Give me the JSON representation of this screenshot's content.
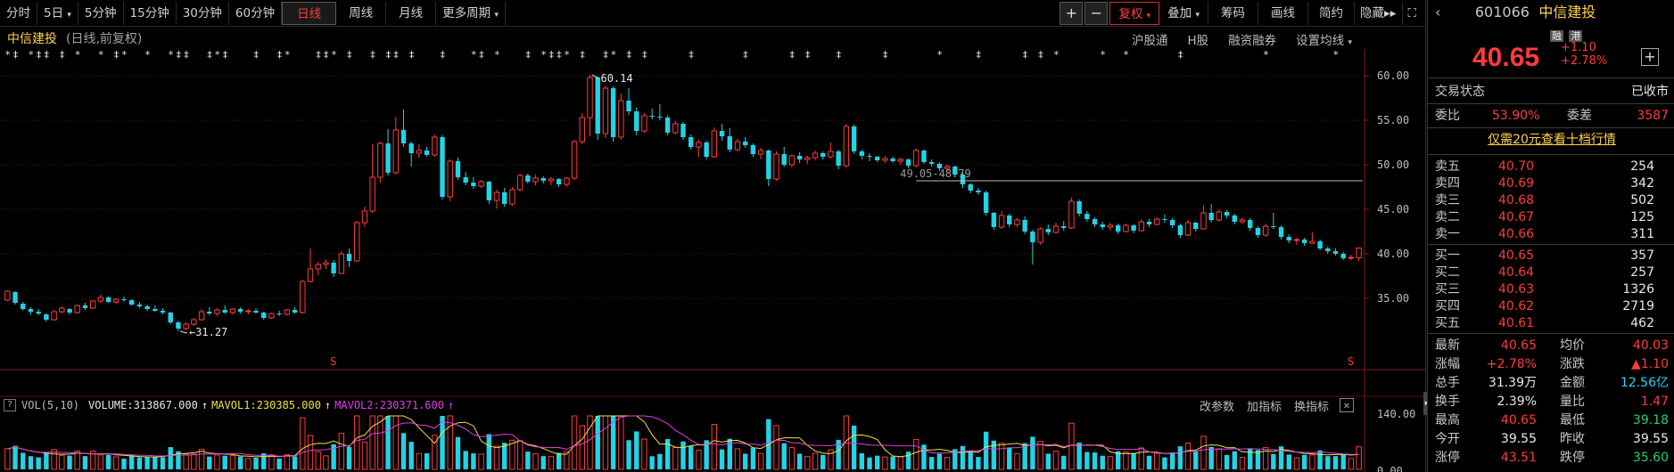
{
  "toolbar": {
    "periods": [
      "分时",
      "5日",
      "5分钟",
      "15分钟",
      "30分钟",
      "60分钟",
      "日线",
      "周线",
      "月线",
      "更多周期"
    ],
    "active_period": "日线",
    "right_buttons": [
      "复权",
      "叠加",
      "筹码",
      "画线",
      "简约",
      "隐藏"
    ],
    "plus": "+",
    "minus": "−"
  },
  "chart_header": {
    "stock_name": "中信建投",
    "subtitle": "(日线,前复权)",
    "links": [
      "沪股通",
      "H股",
      "融资融券",
      "设置均线"
    ]
  },
  "volume_header": {
    "indicator": "VOL(5,10)",
    "volume": "VOLUME:313867.000",
    "mavol1": "MAVOL1:230385.000",
    "mavol2": "MAVOL2:230371.600",
    "links": [
      "改参数",
      "加指标",
      "换指标"
    ]
  },
  "chart_data": {
    "type": "candlestick",
    "price_axis_ticks": [
      "60.00",
      "55.00",
      "50.00",
      "45.00",
      "40.00",
      "35.00"
    ],
    "ylim": [
      31.5,
      61.0
    ],
    "volume_axis_ticks": [
      "140.00",
      "0.00"
    ],
    "high_label": "60.14",
    "low_label": "31.27",
    "range_line_label": "49.05-48.79",
    "candles": [
      {
        "o": 34.8,
        "h": 35.9,
        "l": 34.7,
        "c": 35.8
      },
      {
        "o": 35.7,
        "h": 35.8,
        "l": 34.3,
        "c": 34.5
      },
      {
        "o": 34.4,
        "h": 34.6,
        "l": 33.6,
        "c": 33.8
      },
      {
        "o": 33.8,
        "h": 34.0,
        "l": 33.2,
        "c": 33.5
      },
      {
        "o": 33.5,
        "h": 33.8,
        "l": 33.1,
        "c": 33.3
      },
      {
        "o": 33.2,
        "h": 33.3,
        "l": 32.4,
        "c": 32.6
      },
      {
        "o": 32.6,
        "h": 33.7,
        "l": 32.5,
        "c": 33.5
      },
      {
        "o": 33.5,
        "h": 34.1,
        "l": 33.3,
        "c": 33.9
      },
      {
        "o": 33.8,
        "h": 33.9,
        "l": 33.2,
        "c": 33.4
      },
      {
        "o": 33.4,
        "h": 34.3,
        "l": 33.3,
        "c": 34.2
      },
      {
        "o": 34.2,
        "h": 34.5,
        "l": 33.7,
        "c": 33.9
      },
      {
        "o": 33.9,
        "h": 34.8,
        "l": 33.8,
        "c": 34.7
      },
      {
        "o": 34.7,
        "h": 35.4,
        "l": 34.5,
        "c": 35.1
      },
      {
        "o": 35.1,
        "h": 35.2,
        "l": 34.5,
        "c": 34.6
      },
      {
        "o": 34.6,
        "h": 35.0,
        "l": 34.4,
        "c": 34.9
      },
      {
        "o": 34.9,
        "h": 35.2,
        "l": 34.6,
        "c": 34.8
      },
      {
        "o": 34.8,
        "h": 34.9,
        "l": 34.2,
        "c": 34.3
      },
      {
        "o": 34.3,
        "h": 34.6,
        "l": 33.9,
        "c": 34.1
      },
      {
        "o": 34.1,
        "h": 34.3,
        "l": 33.6,
        "c": 33.8
      },
      {
        "o": 33.8,
        "h": 34.2,
        "l": 33.5,
        "c": 33.6
      },
      {
        "o": 33.6,
        "h": 33.9,
        "l": 33.2,
        "c": 33.4
      },
      {
        "o": 33.4,
        "h": 33.5,
        "l": 32.1,
        "c": 32.3
      },
      {
        "o": 32.3,
        "h": 32.5,
        "l": 31.3,
        "c": 31.6
      },
      {
        "o": 31.6,
        "h": 32.3,
        "l": 31.4,
        "c": 32.1
      },
      {
        "o": 32.1,
        "h": 32.8,
        "l": 31.9,
        "c": 32.6
      },
      {
        "o": 32.6,
        "h": 33.8,
        "l": 32.5,
        "c": 33.5
      },
      {
        "o": 33.5,
        "h": 34.0,
        "l": 33.1,
        "c": 33.3
      },
      {
        "o": 33.3,
        "h": 33.9,
        "l": 33.0,
        "c": 33.7
      },
      {
        "o": 33.7,
        "h": 34.2,
        "l": 33.3,
        "c": 33.4
      },
      {
        "o": 33.4,
        "h": 33.9,
        "l": 33.2,
        "c": 33.8
      },
      {
        "o": 33.8,
        "h": 34.0,
        "l": 33.3,
        "c": 33.5
      },
      {
        "o": 33.5,
        "h": 33.8,
        "l": 33.2,
        "c": 33.6
      },
      {
        "o": 33.6,
        "h": 33.9,
        "l": 33.3,
        "c": 33.4
      },
      {
        "o": 33.4,
        "h": 33.5,
        "l": 32.6,
        "c": 32.8
      },
      {
        "o": 32.8,
        "h": 33.4,
        "l": 32.7,
        "c": 33.3
      },
      {
        "o": 33.3,
        "h": 33.6,
        "l": 33.0,
        "c": 33.2
      },
      {
        "o": 33.2,
        "h": 33.8,
        "l": 33.1,
        "c": 33.7
      },
      {
        "o": 33.7,
        "h": 34.0,
        "l": 33.3,
        "c": 33.4
      },
      {
        "o": 33.4,
        "h": 37.1,
        "l": 33.3,
        "c": 36.9
      },
      {
        "o": 36.9,
        "h": 40.6,
        "l": 36.8,
        "c": 38.3
      },
      {
        "o": 38.3,
        "h": 39.1,
        "l": 37.6,
        "c": 38.8
      },
      {
        "o": 38.8,
        "h": 39.4,
        "l": 38.3,
        "c": 39.0
      },
      {
        "o": 39.0,
        "h": 39.3,
        "l": 37.4,
        "c": 37.8
      },
      {
        "o": 37.8,
        "h": 40.3,
        "l": 37.7,
        "c": 40.0
      },
      {
        "o": 40.0,
        "h": 40.6,
        "l": 38.5,
        "c": 39.2
      },
      {
        "o": 39.2,
        "h": 43.7,
        "l": 39.1,
        "c": 43.5
      },
      {
        "o": 43.5,
        "h": 45.3,
        "l": 43.0,
        "c": 44.8
      },
      {
        "o": 44.8,
        "h": 52.3,
        "l": 44.6,
        "c": 48.6
      },
      {
        "o": 48.6,
        "h": 52.6,
        "l": 48.0,
        "c": 52.4
      },
      {
        "o": 52.4,
        "h": 54.0,
        "l": 48.8,
        "c": 49.1
      },
      {
        "o": 49.1,
        "h": 55.4,
        "l": 48.9,
        "c": 53.9
      },
      {
        "o": 53.9,
        "h": 56.2,
        "l": 52.0,
        "c": 52.4
      },
      {
        "o": 52.4,
        "h": 52.6,
        "l": 49.8,
        "c": 51.3
      },
      {
        "o": 51.3,
        "h": 52.3,
        "l": 50.8,
        "c": 51.6
      },
      {
        "o": 51.6,
        "h": 52.0,
        "l": 50.9,
        "c": 51.1
      },
      {
        "o": 51.1,
        "h": 53.4,
        "l": 50.9,
        "c": 53.1
      },
      {
        "o": 53.1,
        "h": 53.3,
        "l": 46.1,
        "c": 46.4
      },
      {
        "o": 46.4,
        "h": 50.6,
        "l": 45.9,
        "c": 50.4
      },
      {
        "o": 50.4,
        "h": 50.8,
        "l": 48.3,
        "c": 48.6
      },
      {
        "o": 48.6,
        "h": 49.2,
        "l": 47.7,
        "c": 48.0
      },
      {
        "o": 48.0,
        "h": 48.6,
        "l": 47.3,
        "c": 47.6
      },
      {
        "o": 47.6,
        "h": 48.3,
        "l": 47.4,
        "c": 48.1
      },
      {
        "o": 48.1,
        "h": 48.2,
        "l": 45.6,
        "c": 46.0
      },
      {
        "o": 46.0,
        "h": 47.2,
        "l": 45.1,
        "c": 46.9
      },
      {
        "o": 46.9,
        "h": 47.4,
        "l": 45.3,
        "c": 45.6
      },
      {
        "o": 45.6,
        "h": 47.5,
        "l": 45.4,
        "c": 47.2
      },
      {
        "o": 47.2,
        "h": 49.0,
        "l": 47.0,
        "c": 48.8
      },
      {
        "o": 48.8,
        "h": 49.0,
        "l": 47.9,
        "c": 48.1
      },
      {
        "o": 48.1,
        "h": 48.9,
        "l": 47.7,
        "c": 48.5
      },
      {
        "o": 48.5,
        "h": 48.7,
        "l": 47.9,
        "c": 48.2
      },
      {
        "o": 48.2,
        "h": 48.6,
        "l": 47.7,
        "c": 48.4
      },
      {
        "o": 48.4,
        "h": 48.5,
        "l": 47.5,
        "c": 47.8
      },
      {
        "o": 47.8,
        "h": 48.6,
        "l": 47.5,
        "c": 48.5
      },
      {
        "o": 48.5,
        "h": 52.8,
        "l": 48.3,
        "c": 52.6
      },
      {
        "o": 52.6,
        "h": 55.8,
        "l": 52.3,
        "c": 55.3
      },
      {
        "o": 55.3,
        "h": 60.1,
        "l": 53.2,
        "c": 59.8
      },
      {
        "o": 59.8,
        "h": 59.9,
        "l": 52.8,
        "c": 53.5
      },
      {
        "o": 53.5,
        "h": 58.9,
        "l": 53.0,
        "c": 58.6
      },
      {
        "o": 58.6,
        "h": 58.8,
        "l": 52.6,
        "c": 53.1
      },
      {
        "o": 53.1,
        "h": 58.0,
        "l": 52.8,
        "c": 57.2
      },
      {
        "o": 57.2,
        "h": 58.6,
        "l": 55.6,
        "c": 56.0
      },
      {
        "o": 56.0,
        "h": 56.4,
        "l": 53.3,
        "c": 53.8
      },
      {
        "o": 53.8,
        "h": 55.8,
        "l": 53.6,
        "c": 55.5
      },
      {
        "o": 55.5,
        "h": 56.3,
        "l": 55.1,
        "c": 55.4
      },
      {
        "o": 55.4,
        "h": 56.8,
        "l": 55.0,
        "c": 55.3
      },
      {
        "o": 55.3,
        "h": 55.5,
        "l": 53.3,
        "c": 53.6
      },
      {
        "o": 53.6,
        "h": 54.9,
        "l": 53.4,
        "c": 54.6
      },
      {
        "o": 54.6,
        "h": 54.8,
        "l": 52.8,
        "c": 53.1
      },
      {
        "o": 53.1,
        "h": 53.4,
        "l": 51.7,
        "c": 52.0
      },
      {
        "o": 52.0,
        "h": 52.8,
        "l": 50.9,
        "c": 52.5
      },
      {
        "o": 52.5,
        "h": 52.7,
        "l": 50.6,
        "c": 50.9
      },
      {
        "o": 50.9,
        "h": 54.2,
        "l": 50.8,
        "c": 53.8
      },
      {
        "o": 53.8,
        "h": 54.6,
        "l": 52.7,
        "c": 53.2
      },
      {
        "o": 53.2,
        "h": 54.1,
        "l": 51.4,
        "c": 51.7
      },
      {
        "o": 51.7,
        "h": 52.9,
        "l": 51.5,
        "c": 52.6
      },
      {
        "o": 52.6,
        "h": 53.1,
        "l": 51.9,
        "c": 52.2
      },
      {
        "o": 52.2,
        "h": 52.4,
        "l": 50.9,
        "c": 51.2
      },
      {
        "o": 51.2,
        "h": 51.9,
        "l": 50.6,
        "c": 51.6
      },
      {
        "o": 51.6,
        "h": 51.7,
        "l": 47.6,
        "c": 48.4
      },
      {
        "o": 48.4,
        "h": 51.5,
        "l": 48.2,
        "c": 51.2
      },
      {
        "o": 51.2,
        "h": 52.0,
        "l": 49.8,
        "c": 50.0
      },
      {
        "o": 50.0,
        "h": 51.2,
        "l": 49.7,
        "c": 51.0
      },
      {
        "o": 51.0,
        "h": 51.4,
        "l": 50.2,
        "c": 50.6
      },
      {
        "o": 50.6,
        "h": 51.0,
        "l": 50.1,
        "c": 50.8
      },
      {
        "o": 50.8,
        "h": 51.6,
        "l": 50.5,
        "c": 51.3
      },
      {
        "o": 51.3,
        "h": 51.5,
        "l": 50.6,
        "c": 50.9
      },
      {
        "o": 50.9,
        "h": 52.5,
        "l": 50.7,
        "c": 51.5
      },
      {
        "o": 51.5,
        "h": 51.7,
        "l": 49.5,
        "c": 49.9
      },
      {
        "o": 49.9,
        "h": 54.6,
        "l": 49.7,
        "c": 54.3
      },
      {
        "o": 54.3,
        "h": 54.5,
        "l": 51.2,
        "c": 51.5
      },
      {
        "o": 51.5,
        "h": 51.7,
        "l": 50.6,
        "c": 51.0
      },
      {
        "o": 51.0,
        "h": 51.3,
        "l": 50.4,
        "c": 50.9
      },
      {
        "o": 50.9,
        "h": 51.0,
        "l": 50.3,
        "c": 50.5
      },
      {
        "o": 50.5,
        "h": 51.0,
        "l": 50.2,
        "c": 50.7
      },
      {
        "o": 50.7,
        "h": 50.9,
        "l": 50.2,
        "c": 50.4
      },
      {
        "o": 50.4,
        "h": 50.8,
        "l": 50.0,
        "c": 50.6
      },
      {
        "o": 50.6,
        "h": 50.7,
        "l": 49.6,
        "c": 49.9
      },
      {
        "o": 49.9,
        "h": 51.8,
        "l": 49.7,
        "c": 51.6
      },
      {
        "o": 51.6,
        "h": 51.7,
        "l": 50.1,
        "c": 50.3
      },
      {
        "o": 50.3,
        "h": 50.6,
        "l": 49.8,
        "c": 50.1
      },
      {
        "o": 50.1,
        "h": 50.3,
        "l": 49.3,
        "c": 49.6
      },
      {
        "o": 49.6,
        "h": 50.0,
        "l": 49.3,
        "c": 49.8
      },
      {
        "o": 49.8,
        "h": 49.9,
        "l": 48.6,
        "c": 48.9
      },
      {
        "o": 48.9,
        "h": 49.1,
        "l": 47.4,
        "c": 47.8
      },
      {
        "o": 47.8,
        "h": 47.9,
        "l": 46.8,
        "c": 47.1
      },
      {
        "o": 47.1,
        "h": 47.4,
        "l": 46.6,
        "c": 46.9
      },
      {
        "o": 46.9,
        "h": 47.1,
        "l": 44.3,
        "c": 44.6
      },
      {
        "o": 44.6,
        "h": 44.7,
        "l": 42.7,
        "c": 43.0
      },
      {
        "o": 43.0,
        "h": 44.8,
        "l": 42.8,
        "c": 44.3
      },
      {
        "o": 44.3,
        "h": 44.5,
        "l": 43.0,
        "c": 43.3
      },
      {
        "o": 43.3,
        "h": 44.0,
        "l": 43.0,
        "c": 43.8
      },
      {
        "o": 43.8,
        "h": 44.2,
        "l": 42.2,
        "c": 42.5
      },
      {
        "o": 42.5,
        "h": 42.7,
        "l": 38.8,
        "c": 41.3
      },
      {
        "o": 41.3,
        "h": 43.0,
        "l": 41.0,
        "c": 42.8
      },
      {
        "o": 42.8,
        "h": 43.3,
        "l": 42.1,
        "c": 42.4
      },
      {
        "o": 42.4,
        "h": 43.5,
        "l": 42.3,
        "c": 43.1
      },
      {
        "o": 43.1,
        "h": 43.7,
        "l": 42.6,
        "c": 42.9
      },
      {
        "o": 42.9,
        "h": 46.3,
        "l": 42.8,
        "c": 45.9
      },
      {
        "o": 45.9,
        "h": 46.1,
        "l": 44.2,
        "c": 44.5
      },
      {
        "o": 44.5,
        "h": 44.8,
        "l": 43.6,
        "c": 43.9
      },
      {
        "o": 43.9,
        "h": 44.1,
        "l": 43.0,
        "c": 43.3
      },
      {
        "o": 43.3,
        "h": 43.6,
        "l": 42.7,
        "c": 43.0
      },
      {
        "o": 43.0,
        "h": 43.5,
        "l": 42.6,
        "c": 43.2
      },
      {
        "o": 43.2,
        "h": 43.4,
        "l": 42.2,
        "c": 42.5
      },
      {
        "o": 42.5,
        "h": 43.4,
        "l": 42.4,
        "c": 43.2
      },
      {
        "o": 43.2,
        "h": 43.3,
        "l": 42.3,
        "c": 42.6
      },
      {
        "o": 42.6,
        "h": 43.9,
        "l": 42.5,
        "c": 43.6
      },
      {
        "o": 43.6,
        "h": 43.9,
        "l": 43.0,
        "c": 43.3
      },
      {
        "o": 43.3,
        "h": 44.1,
        "l": 43.2,
        "c": 43.9
      },
      {
        "o": 43.9,
        "h": 44.4,
        "l": 43.5,
        "c": 43.8
      },
      {
        "o": 43.8,
        "h": 44.0,
        "l": 42.9,
        "c": 43.2
      },
      {
        "o": 43.2,
        "h": 43.4,
        "l": 41.8,
        "c": 42.1
      },
      {
        "o": 42.1,
        "h": 43.8,
        "l": 42.0,
        "c": 43.5
      },
      {
        "o": 43.5,
        "h": 43.6,
        "l": 42.5,
        "c": 42.8
      },
      {
        "o": 42.8,
        "h": 45.4,
        "l": 42.7,
        "c": 44.6
      },
      {
        "o": 44.6,
        "h": 45.6,
        "l": 43.5,
        "c": 43.8
      },
      {
        "o": 43.8,
        "h": 45.0,
        "l": 43.6,
        "c": 44.7
      },
      {
        "o": 44.7,
        "h": 44.9,
        "l": 44.0,
        "c": 44.3
      },
      {
        "o": 44.3,
        "h": 44.5,
        "l": 43.3,
        "c": 43.6
      },
      {
        "o": 43.6,
        "h": 44.1,
        "l": 43.4,
        "c": 43.8
      },
      {
        "o": 43.8,
        "h": 44.0,
        "l": 42.6,
        "c": 42.9
      },
      {
        "o": 42.9,
        "h": 43.1,
        "l": 41.8,
        "c": 42.1
      },
      {
        "o": 42.1,
        "h": 43.4,
        "l": 41.9,
        "c": 43.1
      },
      {
        "o": 43.1,
        "h": 44.6,
        "l": 42.8,
        "c": 43.0
      },
      {
        "o": 43.0,
        "h": 43.2,
        "l": 41.6,
        "c": 41.9
      },
      {
        "o": 41.9,
        "h": 42.2,
        "l": 41.2,
        "c": 41.5
      },
      {
        "o": 41.5,
        "h": 41.8,
        "l": 41.0,
        "c": 41.6
      },
      {
        "o": 41.6,
        "h": 41.8,
        "l": 40.9,
        "c": 41.2
      },
      {
        "o": 41.2,
        "h": 42.4,
        "l": 41.1,
        "c": 41.4
      },
      {
        "o": 41.4,
        "h": 41.6,
        "l": 40.4,
        "c": 40.6
      },
      {
        "o": 40.6,
        "h": 40.8,
        "l": 40.0,
        "c": 40.3
      },
      {
        "o": 40.3,
        "h": 40.6,
        "l": 39.8,
        "c": 40.0
      },
      {
        "o": 40.0,
        "h": 40.2,
        "l": 39.3,
        "c": 39.5
      },
      {
        "o": 39.5,
        "h": 39.9,
        "l": 39.3,
        "c": 39.6
      },
      {
        "o": 39.55,
        "h": 40.65,
        "l": 39.18,
        "c": 40.65
      }
    ]
  },
  "panel": {
    "code": "601066",
    "name": "中信建投",
    "badge1": "融",
    "badge2": "港",
    "price": "40.65",
    "change": "+1.10",
    "change_pct": "+2.78%",
    "status_label": "交易状态",
    "status_value": "已收市",
    "webi_label": "委比",
    "webi_value": "53.90%",
    "weicha_label": "委差",
    "weicha_value": "3587",
    "promo": "仅需20元查看十档行情",
    "sell": [
      {
        "label": "卖五",
        "price": "40.70",
        "vol": "254"
      },
      {
        "label": "卖四",
        "price": "40.69",
        "vol": "342"
      },
      {
        "label": "卖三",
        "price": "40.68",
        "vol": "502"
      },
      {
        "label": "卖二",
        "price": "40.67",
        "vol": "125"
      },
      {
        "label": "卖一",
        "price": "40.66",
        "vol": "311"
      }
    ],
    "buy": [
      {
        "label": "买一",
        "price": "40.65",
        "vol": "357"
      },
      {
        "label": "买二",
        "price": "40.64",
        "vol": "257"
      },
      {
        "label": "买三",
        "price": "40.63",
        "vol": "1326"
      },
      {
        "label": "买四",
        "price": "40.62",
        "vol": "2719"
      },
      {
        "label": "买五",
        "price": "40.61",
        "vol": "462"
      }
    ],
    "stats": [
      {
        "l1": "最新",
        "v1": "40.65",
        "l2": "均价",
        "v2": "40.03",
        "c1": "red",
        "c2": "red"
      },
      {
        "l1": "涨幅",
        "v1": "+2.78%",
        "l2": "涨跌",
        "v2": "▲1.10",
        "c1": "red",
        "c2": "red"
      },
      {
        "l1": "总手",
        "v1": "31.39万",
        "l2": "金额",
        "v2": "12.56亿",
        "c1": "white",
        "c2": "cyan"
      },
      {
        "l1": "换手",
        "v1": "2.39%",
        "l2": "量比",
        "v2": "1.47",
        "c1": "white",
        "c2": "red"
      },
      {
        "l1": "最高",
        "v1": "40.65",
        "l2": "最低",
        "v2": "39.18",
        "c1": "red",
        "c2": "green"
      },
      {
        "l1": "今开",
        "v1": "39.55",
        "l2": "昨收",
        "v2": "39.55",
        "c1": "white",
        "c2": "white"
      },
      {
        "l1": "涨停",
        "v1": "43.51",
        "l2": "跌停",
        "v2": "35.60",
        "c1": "red",
        "c2": "green"
      }
    ]
  },
  "colors": {
    "up": "#ff3b3b",
    "down": "#22d3e6",
    "mavol1": "#f0e040",
    "mavol2": "#e040e0",
    "grid": "#6a1212"
  }
}
